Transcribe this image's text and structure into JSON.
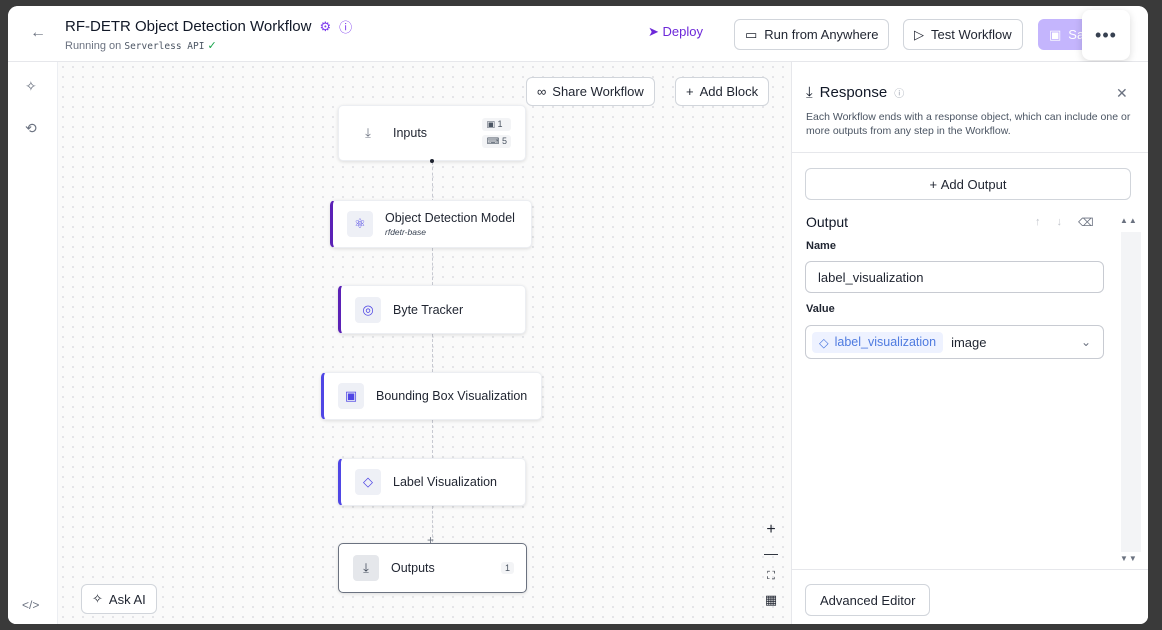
{
  "header": {
    "title": "RF-DETR Object Detection Workflow",
    "subtitle_prefix": "Running on",
    "subtitle_runtime": "Serverless API",
    "deploy_label": "Deploy",
    "run_anywhere_label": "Run from Anywhere",
    "test_label": "Test Workflow",
    "save_label": "Sav"
  },
  "canvas": {
    "share_label": "Share Workflow",
    "add_block_label": "Add Block",
    "ask_ai_label": "Ask AI",
    "nodes": [
      {
        "label": "Inputs",
        "badges": [
          "1",
          "5"
        ]
      },
      {
        "label": "Object Detection Model",
        "sub": "rfdetr-base"
      },
      {
        "label": "Byte Tracker"
      },
      {
        "label": "Bounding Box Visualization"
      },
      {
        "label": "Label Visualization"
      },
      {
        "label": "Outputs",
        "badge": "1"
      }
    ]
  },
  "panel": {
    "title": "Response",
    "description": "Each Workflow ends with a response object, which can include one or more outputs from any step in the Workflow.",
    "add_output_label": "Add Output",
    "output_title": "Output",
    "name_label": "Name",
    "name_value": "label_visualization",
    "value_label": "Value",
    "value_chip": "label_visualization",
    "value_type": "image",
    "advanced_label": "Advanced Editor"
  },
  "colors": {
    "accent": "#5b21b6",
    "deploy": "#6d28d9",
    "chip": "#4f7be0"
  },
  "icons": [
    "back-arrow-icon",
    "gear-icon",
    "help-icon",
    "rocket-icon",
    "phone-icon",
    "play-icon",
    "save-icon",
    "more-icon",
    "sparkle-icon",
    "history-icon",
    "code-icon",
    "share-icon",
    "download-icon",
    "image-icon",
    "keyboard-icon",
    "model-icon",
    "tracker-icon",
    "box-icon",
    "tag-icon",
    "output-icon",
    "zoom-in-icon",
    "zoom-out-icon",
    "fit-icon",
    "map-icon",
    "close-icon",
    "trash-icon",
    "chevron-down-icon"
  ]
}
